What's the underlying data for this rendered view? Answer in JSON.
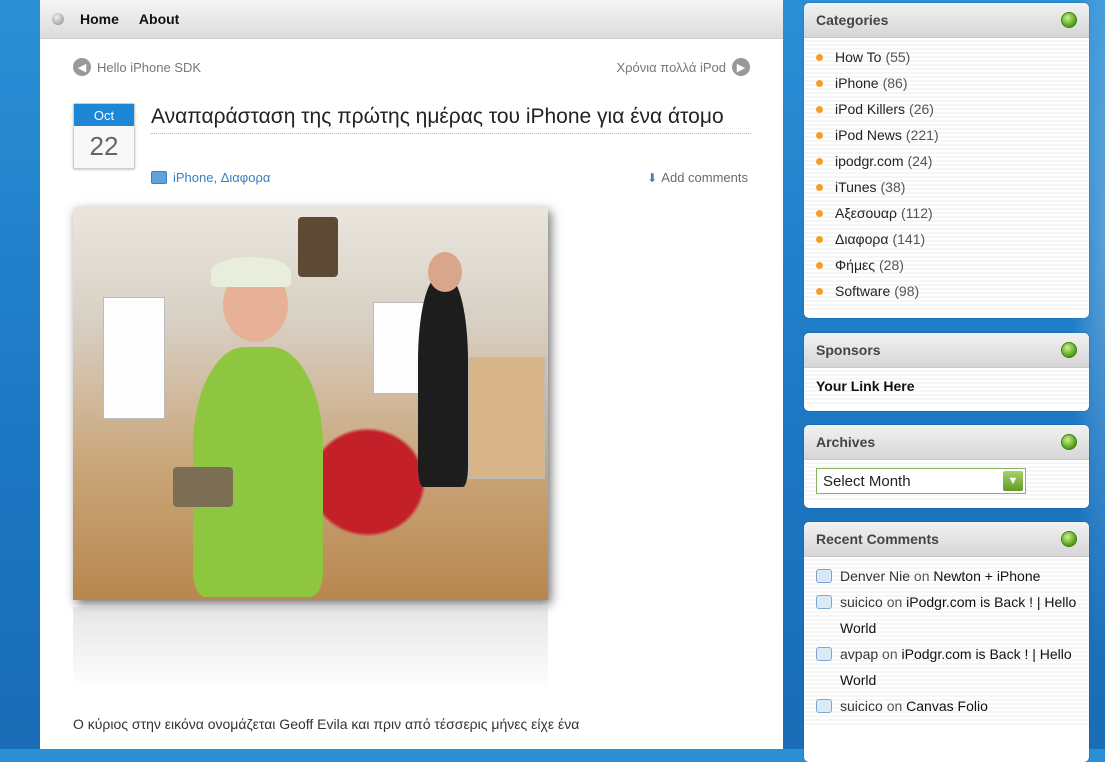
{
  "nav": {
    "home": "Home",
    "about": "About"
  },
  "post_nav": {
    "prev": "Hello iPhone SDK",
    "next": "Χρόνια πολλά iPod"
  },
  "post": {
    "month": "Oct",
    "day": "22",
    "title": "Αναπαράσταση της πρώτης ημέρας του iPhone για ένα άτομο",
    "categories": "iPhone, Διαφορα",
    "add_comments": "Add comments",
    "excerpt": "Ο κύριος στην εικόνα ονομάζεται Geoff Evila και πριν από τέσσερις μήνες είχε ένα"
  },
  "sidebar": {
    "categories": {
      "title": "Categories",
      "items": [
        {
          "name": "How To",
          "count": "(55)"
        },
        {
          "name": "iPhone",
          "count": "(86)"
        },
        {
          "name": "iPod Killers",
          "count": "(26)"
        },
        {
          "name": "iPod News",
          "count": "(221)"
        },
        {
          "name": "ipodgr.com",
          "count": "(24)"
        },
        {
          "name": "iTunes",
          "count": "(38)"
        },
        {
          "name": "Αξεσουαρ",
          "count": "(112)"
        },
        {
          "name": "Διαφορα",
          "count": "(141)"
        },
        {
          "name": "Φήμες",
          "count": "(28)"
        },
        {
          "name": "Software",
          "count": "(98)"
        }
      ]
    },
    "sponsors": {
      "title": "Sponsors",
      "link": "Your Link Here"
    },
    "archives": {
      "title": "Archives",
      "select_value": "Select Month"
    },
    "recent_comments": {
      "title": "Recent Comments",
      "items": [
        {
          "author": "Denver Nie",
          "on": "on",
          "post": "Newton + iPhone"
        },
        {
          "author": "suicico",
          "on": "on",
          "post": "iPodgr.com is Back ! | Hello World"
        },
        {
          "author": "avpap",
          "on": "on",
          "post": "iPodgr.com is Back ! | Hello World"
        },
        {
          "author": "suicico",
          "on": "on",
          "post": "Canvas Folio"
        }
      ]
    }
  },
  "colors": {
    "accent": "#1d87d6",
    "widget_ball": "#4f9b17",
    "bullet": "#f0a12a"
  }
}
